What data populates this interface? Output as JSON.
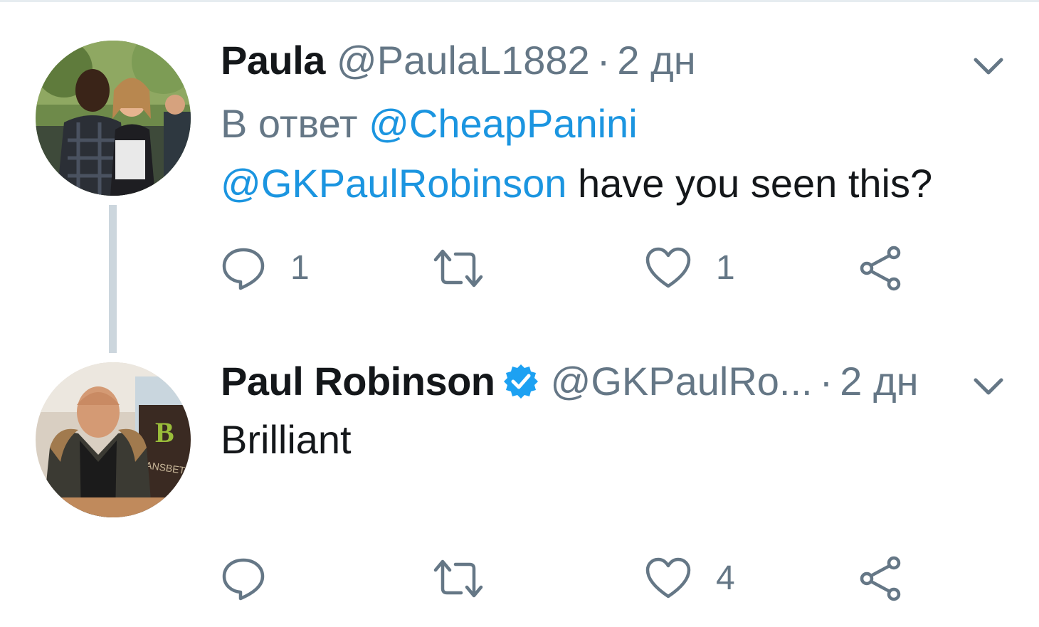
{
  "tweets": [
    {
      "display_name": "Paula",
      "handle": "@PaulaL1882",
      "separator": "·",
      "time": "2 дн",
      "reply_prefix": "В ответ",
      "reply_to": "@CheapPanini",
      "mention": "@GKPaulRobinson",
      "text": "have you seen this?",
      "counts": {
        "reply": "1",
        "retweet": "",
        "like": "1"
      }
    },
    {
      "display_name": "Paul Robinson",
      "verified": true,
      "handle": "@GKPaulRo...",
      "separator": "·",
      "time": "2 дн",
      "text": "Brilliant",
      "counts": {
        "reply": "",
        "retweet": "",
        "like": "4"
      }
    }
  ],
  "icons": {
    "reply": "reply-icon",
    "retweet": "retweet-icon",
    "like": "heart-icon",
    "share": "share-icon",
    "menu": "chevron-down-icon",
    "verified": "verified-badge-icon"
  },
  "colors": {
    "link": "#1b95e0",
    "secondary": "#657786",
    "primary_text": "#14171a",
    "thread_line": "#ccd6dd",
    "verified": "#1da1f2"
  }
}
